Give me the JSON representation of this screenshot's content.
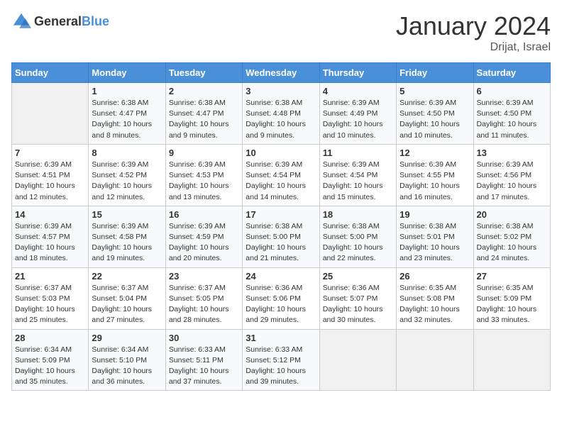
{
  "logo": {
    "text_general": "General",
    "text_blue": "Blue"
  },
  "header": {
    "title": "January 2024",
    "subtitle": "Drijat, Israel"
  },
  "days_of_week": [
    "Sunday",
    "Monday",
    "Tuesday",
    "Wednesday",
    "Thursday",
    "Friday",
    "Saturday"
  ],
  "weeks": [
    [
      {
        "day": "",
        "info": ""
      },
      {
        "day": "1",
        "info": "Sunrise: 6:38 AM\nSunset: 4:47 PM\nDaylight: 10 hours\nand 8 minutes."
      },
      {
        "day": "2",
        "info": "Sunrise: 6:38 AM\nSunset: 4:47 PM\nDaylight: 10 hours\nand 9 minutes."
      },
      {
        "day": "3",
        "info": "Sunrise: 6:38 AM\nSunset: 4:48 PM\nDaylight: 10 hours\nand 9 minutes."
      },
      {
        "day": "4",
        "info": "Sunrise: 6:39 AM\nSunset: 4:49 PM\nDaylight: 10 hours\nand 10 minutes."
      },
      {
        "day": "5",
        "info": "Sunrise: 6:39 AM\nSunset: 4:50 PM\nDaylight: 10 hours\nand 10 minutes."
      },
      {
        "day": "6",
        "info": "Sunrise: 6:39 AM\nSunset: 4:50 PM\nDaylight: 10 hours\nand 11 minutes."
      }
    ],
    [
      {
        "day": "7",
        "info": "Sunrise: 6:39 AM\nSunset: 4:51 PM\nDaylight: 10 hours\nand 12 minutes."
      },
      {
        "day": "8",
        "info": "Sunrise: 6:39 AM\nSunset: 4:52 PM\nDaylight: 10 hours\nand 12 minutes."
      },
      {
        "day": "9",
        "info": "Sunrise: 6:39 AM\nSunset: 4:53 PM\nDaylight: 10 hours\nand 13 minutes."
      },
      {
        "day": "10",
        "info": "Sunrise: 6:39 AM\nSunset: 4:54 PM\nDaylight: 10 hours\nand 14 minutes."
      },
      {
        "day": "11",
        "info": "Sunrise: 6:39 AM\nSunset: 4:54 PM\nDaylight: 10 hours\nand 15 minutes."
      },
      {
        "day": "12",
        "info": "Sunrise: 6:39 AM\nSunset: 4:55 PM\nDaylight: 10 hours\nand 16 minutes."
      },
      {
        "day": "13",
        "info": "Sunrise: 6:39 AM\nSunset: 4:56 PM\nDaylight: 10 hours\nand 17 minutes."
      }
    ],
    [
      {
        "day": "14",
        "info": "Sunrise: 6:39 AM\nSunset: 4:57 PM\nDaylight: 10 hours\nand 18 minutes."
      },
      {
        "day": "15",
        "info": "Sunrise: 6:39 AM\nSunset: 4:58 PM\nDaylight: 10 hours\nand 19 minutes."
      },
      {
        "day": "16",
        "info": "Sunrise: 6:39 AM\nSunset: 4:59 PM\nDaylight: 10 hours\nand 20 minutes."
      },
      {
        "day": "17",
        "info": "Sunrise: 6:38 AM\nSunset: 5:00 PM\nDaylight: 10 hours\nand 21 minutes."
      },
      {
        "day": "18",
        "info": "Sunrise: 6:38 AM\nSunset: 5:00 PM\nDaylight: 10 hours\nand 22 minutes."
      },
      {
        "day": "19",
        "info": "Sunrise: 6:38 AM\nSunset: 5:01 PM\nDaylight: 10 hours\nand 23 minutes."
      },
      {
        "day": "20",
        "info": "Sunrise: 6:38 AM\nSunset: 5:02 PM\nDaylight: 10 hours\nand 24 minutes."
      }
    ],
    [
      {
        "day": "21",
        "info": "Sunrise: 6:37 AM\nSunset: 5:03 PM\nDaylight: 10 hours\nand 25 minutes."
      },
      {
        "day": "22",
        "info": "Sunrise: 6:37 AM\nSunset: 5:04 PM\nDaylight: 10 hours\nand 27 minutes."
      },
      {
        "day": "23",
        "info": "Sunrise: 6:37 AM\nSunset: 5:05 PM\nDaylight: 10 hours\nand 28 minutes."
      },
      {
        "day": "24",
        "info": "Sunrise: 6:36 AM\nSunset: 5:06 PM\nDaylight: 10 hours\nand 29 minutes."
      },
      {
        "day": "25",
        "info": "Sunrise: 6:36 AM\nSunset: 5:07 PM\nDaylight: 10 hours\nand 30 minutes."
      },
      {
        "day": "26",
        "info": "Sunrise: 6:35 AM\nSunset: 5:08 PM\nDaylight: 10 hours\nand 32 minutes."
      },
      {
        "day": "27",
        "info": "Sunrise: 6:35 AM\nSunset: 5:09 PM\nDaylight: 10 hours\nand 33 minutes."
      }
    ],
    [
      {
        "day": "28",
        "info": "Sunrise: 6:34 AM\nSunset: 5:09 PM\nDaylight: 10 hours\nand 35 minutes."
      },
      {
        "day": "29",
        "info": "Sunrise: 6:34 AM\nSunset: 5:10 PM\nDaylight: 10 hours\nand 36 minutes."
      },
      {
        "day": "30",
        "info": "Sunrise: 6:33 AM\nSunset: 5:11 PM\nDaylight: 10 hours\nand 37 minutes."
      },
      {
        "day": "31",
        "info": "Sunrise: 6:33 AM\nSunset: 5:12 PM\nDaylight: 10 hours\nand 39 minutes."
      },
      {
        "day": "",
        "info": ""
      },
      {
        "day": "",
        "info": ""
      },
      {
        "day": "",
        "info": ""
      }
    ]
  ]
}
